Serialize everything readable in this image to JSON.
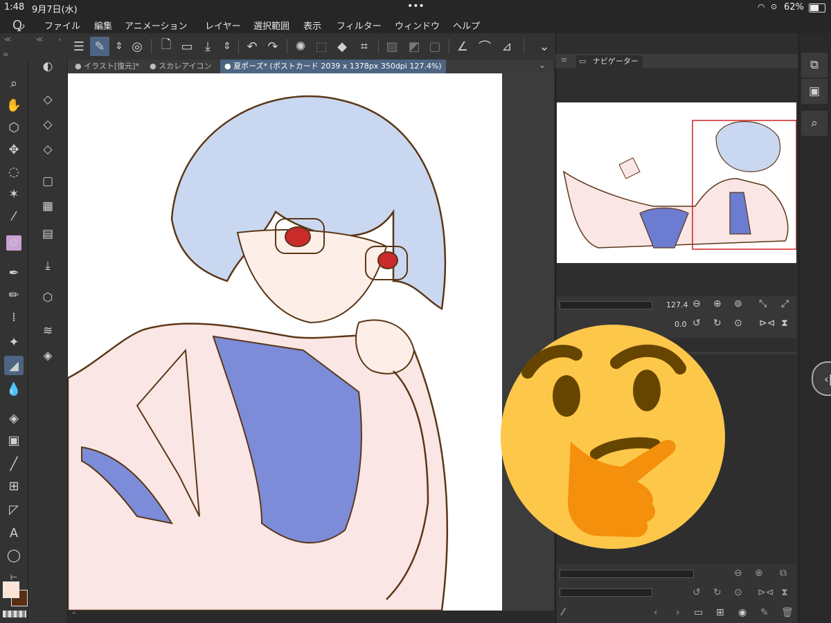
{
  "status_bar": {
    "time": "1:48",
    "date": "9月7日(水)",
    "dots": "•••",
    "battery": "62%"
  },
  "menu": [
    "ファイル",
    "編集",
    "アニメーション",
    "レイヤー",
    "選択範囲",
    "表示",
    "フィルター",
    "ウィンドウ",
    "ヘルプ"
  ],
  "tabs": [
    {
      "label": "イラスト[復元]*"
    },
    {
      "label": "スカレアイコン"
    },
    {
      "label": "夏ポーズ* (ポストカード 2039 x 1378px 350dpi 127.4%)"
    }
  ],
  "navigator": {
    "title": "ナビゲーター",
    "zoom": "127.4",
    "rotation": "0.0"
  },
  "colors": {
    "main": "#fbe3d6",
    "sub": "#5a2e10",
    "accent": "#4d6482"
  },
  "icons": {
    "toolbar": [
      "menu-icon",
      "pen-settings-icon",
      "sub-tool-arrows-icon",
      "spiral-icon",
      "new-file-icon",
      "open-folder-icon",
      "save-icon",
      "arrows-icon",
      "undo-icon",
      "redo-icon",
      "loading-icon",
      "select-all-icon",
      "fill-icon",
      "transform-icon",
      "clear-icon",
      "flip-icon",
      "border-icon",
      "ruler-pen-icon",
      "brush-tip-icon",
      "line-icon",
      "expand-icon"
    ],
    "tools": [
      "view-rotate-icon",
      "zoom-icon",
      "hand-icon",
      "object-icon",
      "move-icon",
      "lasso-icon",
      "magic-wand-icon",
      "eyedropper-icon",
      "sticker-icon",
      "pen-icon",
      "pencil-icon",
      "airbrush-icon",
      "sparkle-icon",
      "eraser-icon",
      "blend-icon",
      "fill-bucket-icon",
      "gradient-icon",
      "line-tool-icon",
      "frame-icon",
      "ruler-icon",
      "text-icon",
      "balloon-icon",
      "correct-line-icon"
    ]
  }
}
